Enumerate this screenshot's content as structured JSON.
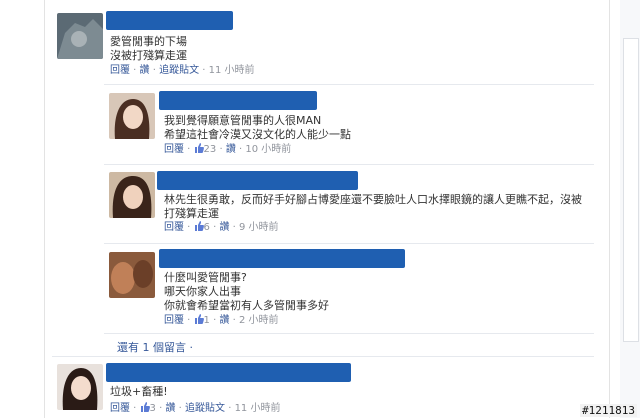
{
  "watermark": "#1211813",
  "more_replies": "還有 1 個留言 ·",
  "comments": [
    {
      "text": "愛管閒事的下場\n沒被打殘算走運",
      "actions": [
        "回覆",
        "讚",
        "追蹤貼文"
      ],
      "time": "11 小時前"
    },
    {
      "text": "我到覺得願意管閒事的人很MAN\n希望這社會冷漠又沒文化的人能少一點",
      "actions": [
        "回覆",
        "讚"
      ],
      "likes": "23",
      "time": "10 小時前"
    },
    {
      "text": "林先生很勇敢，反而好手好腳占博愛座還不要臉吐人口水擇眼鏡的讓人更瞧不起，沒被\n打殘算走運",
      "actions": [
        "回覆",
        "讚"
      ],
      "likes": "6",
      "time": "9 小時前"
    },
    {
      "text": "什麼叫愛管閒事?\n哪天你家人出事\n你就會希望當初有人多管閒事多好",
      "actions": [
        "回覆",
        "讚"
      ],
      "likes": "1",
      "time": "2 小時前"
    },
    {
      "text": "垃圾+畜種!",
      "actions": [
        "回覆",
        "讚",
        "追蹤貼文"
      ],
      "likes": "3",
      "time": "11 小時前"
    }
  ],
  "colors": {
    "name_redaction": "#1f5fb1",
    "link": "#365899",
    "meta": "#90949c"
  }
}
